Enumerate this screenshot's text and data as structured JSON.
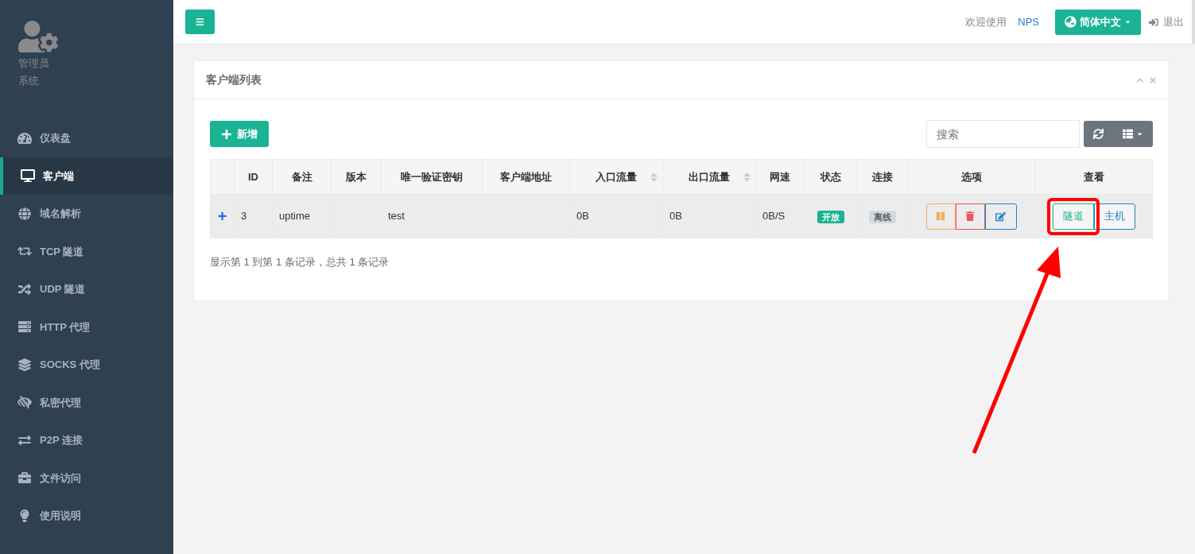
{
  "sidebar": {
    "user": {
      "name": "管理员",
      "role": "系统"
    },
    "items": [
      {
        "label": "仪表盘",
        "selected": false
      },
      {
        "label": "客户端",
        "selected": true
      },
      {
        "label": "域名解析",
        "selected": false
      },
      {
        "label": "TCP 隧道",
        "selected": false
      },
      {
        "label": "UDP 隧道",
        "selected": false
      },
      {
        "label": "HTTP 代理",
        "selected": false
      },
      {
        "label": "SOCKS 代理",
        "selected": false
      },
      {
        "label": "私密代理",
        "selected": false
      },
      {
        "label": "P2P 连接",
        "selected": false
      },
      {
        "label": "文件访问",
        "selected": false
      },
      {
        "label": "使用说明",
        "selected": false
      }
    ]
  },
  "header": {
    "welcome": "欢迎使用",
    "user_link": "NPS",
    "language": "简体中文",
    "logout": "退出"
  },
  "panel": {
    "title": "客户端列表",
    "add_button": "新增",
    "search": {
      "placeholder": "搜索"
    },
    "table": {
      "columns": [
        {
          "sortable": false
        },
        {
          "label": "ID",
          "sortable": false
        },
        {
          "label": "备注",
          "sortable": false
        },
        {
          "label": "版本",
          "sortable": false
        },
        {
          "label": "唯一验证密钥",
          "sortable": false
        },
        {
          "label": "客户端地址",
          "sortable": false
        },
        {
          "label": "入口流量",
          "sortable": true
        },
        {
          "label": "出口流量",
          "sortable": true
        },
        {
          "label": "网速",
          "sortable": false
        },
        {
          "label": "状态",
          "sortable": false
        },
        {
          "label": "连接",
          "sortable": false
        },
        {
          "label": "选项",
          "sortable": false
        },
        {
          "label": "查看",
          "sortable": false
        }
      ],
      "rows": [
        {
          "expand": "+",
          "id": "3",
          "remark": "uptime",
          "key": "test",
          "inflow": "0B",
          "outflow": "0B",
          "speed": "0B/S",
          "status": {
            "text": "开放",
            "on": true
          },
          "connection": {
            "text": "离线",
            "online": false
          },
          "views": [
            {
              "label": "隧道",
              "annotated": true
            },
            {
              "label": "主机",
              "annotated": false
            }
          ]
        }
      ]
    },
    "footer": "显示第 1 到第 1 条记录，总共 1 条记录"
  }
}
